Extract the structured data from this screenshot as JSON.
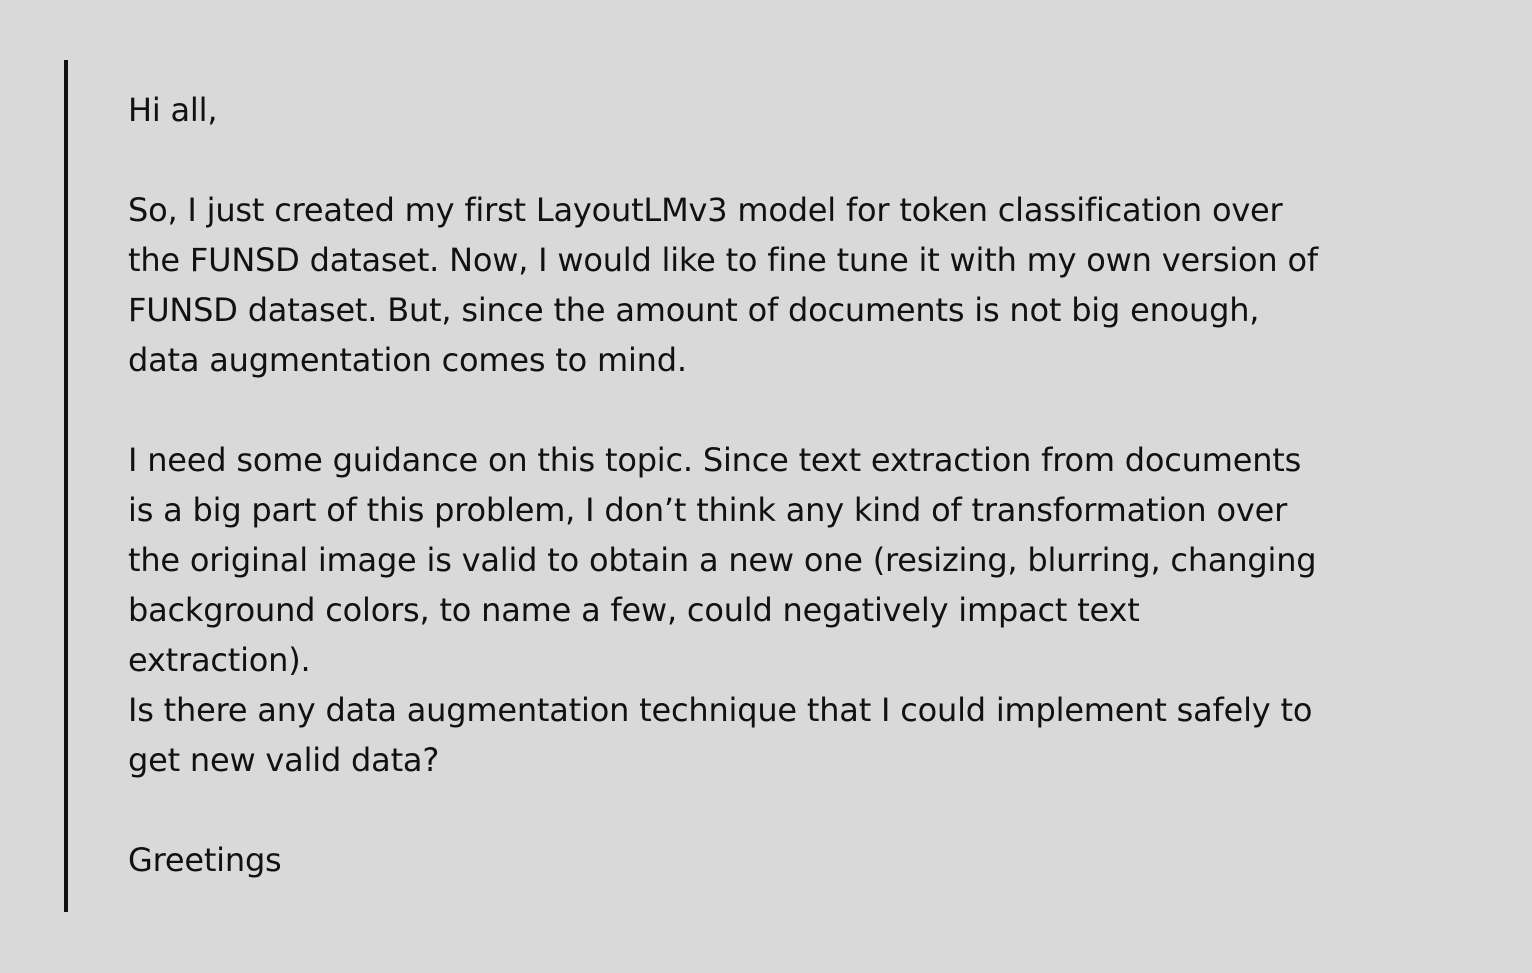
{
  "message": {
    "greeting": "Hi all,",
    "paragraph1": [
      "So, I just created my first LayoutLMv3 model for token classification over",
      "the FUNSD dataset. Now, I would like to fine tune it with my own version of",
      "FUNSD dataset. But, since the amount of documents is not big enough,",
      "data augmentation comes to mind."
    ],
    "paragraph2": [
      "I need some guidance on this topic. Since text extraction from documents",
      "is a big part of this problem, I don’t think any kind of transformation over",
      "the original image is valid to obtain a new one (resizing, blurring, changing",
      "background colors, to name a few, could negatively impact text",
      "extraction).",
      "Is there any data augmentation technique that I could implement safely to",
      "get new valid data?"
    ],
    "signoff": "Greetings"
  },
  "colors": {
    "background": "#d9d9d9",
    "text": "#111111",
    "quote_bar": "#111111"
  }
}
